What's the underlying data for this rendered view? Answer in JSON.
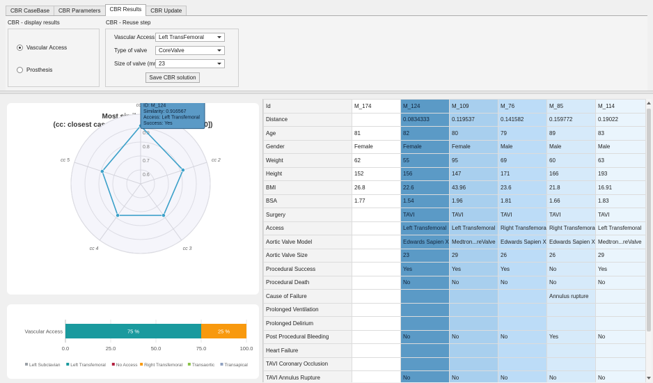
{
  "tabs": [
    {
      "label": "CBR CaseBase",
      "active": false
    },
    {
      "label": "CBR Parameters",
      "active": false
    },
    {
      "label": "CBR Results",
      "active": true
    },
    {
      "label": "CBR Update",
      "active": false
    }
  ],
  "display_results": {
    "title": "CBR - display results",
    "options": [
      {
        "label": "Vascular Access",
        "selected": true
      },
      {
        "label": "Prosthesis",
        "selected": false
      }
    ]
  },
  "reuse_step": {
    "title": "CBR - Reuse step",
    "fields": [
      {
        "label": "Vascular Access",
        "value": "Left TransFemoral"
      },
      {
        "label": "Type of valve",
        "value": "CoreValve"
      },
      {
        "label": "Size of valve (mm)",
        "value": "23"
      }
    ],
    "save_label": "Save CBR solution"
  },
  "radar": {
    "title": "Most similar cases",
    "subtitle": "(cc: closest cases; similarity measure: [0.0, 1.0])",
    "axes": [
      "cc 1",
      "cc 2",
      "cc 3",
      "cc 4",
      "cc 5"
    ],
    "rings": [
      "0.6",
      "0.7",
      "0.8",
      "0.9",
      "1"
    ],
    "tooltip": [
      "ID: M_124",
      "Similarity: 0.916567",
      "Access: Left Transfemoral",
      "Success: Yes"
    ]
  },
  "chart_data": [
    {
      "type": "radar",
      "title": "Most similar cases",
      "subtitle": "(cc: closest cases; similarity measure: [0.0, 1.0])",
      "categories": [
        "cc 1",
        "cc 2",
        "cc 3",
        "cc 4",
        "cc 5"
      ],
      "values": [
        0.9166,
        0.82,
        0.78,
        0.78,
        0.79
      ],
      "range": [
        0.5,
        1.0
      ],
      "series_color": "#3ba0c9"
    },
    {
      "type": "bar",
      "orientation": "horizontal",
      "stacked": true,
      "categories": [
        "Vascular Access"
      ],
      "series": [
        {
          "name": "Left Subclavian",
          "values": [
            0
          ],
          "color": "#9aa0a6"
        },
        {
          "name": "Left Transfemoral",
          "values": [
            75
          ],
          "color": "#1a9a9e"
        },
        {
          "name": "No Access",
          "values": [
            0
          ],
          "color": "#b3203f"
        },
        {
          "name": "Right Transfemoral",
          "values": [
            25
          ],
          "color": "#f8990e"
        },
        {
          "name": "Transaortic",
          "values": [
            0
          ],
          "color": "#8bc34a"
        },
        {
          "name": "Transapical",
          "values": [
            0
          ],
          "color": "#8fa0c0"
        }
      ],
      "segment_labels": [
        "75 %",
        "25 %"
      ],
      "xlim": [
        0,
        100
      ],
      "xticks": [
        "0.0",
        "25.0",
        "50.0",
        "75.0",
        "100.0"
      ],
      "legend": "bottom"
    }
  ],
  "table": {
    "rows": [
      [
        "Id",
        "M_174",
        "M_124",
        "M_109",
        "M_76",
        "M_85",
        "M_114"
      ],
      [
        "Distance",
        "",
        "0.0834333",
        "0.119537",
        "0.141582",
        "0.159772",
        "0.19022"
      ],
      [
        "Age",
        "81",
        "82",
        "80",
        "79",
        "89",
        "83"
      ],
      [
        "Gender",
        "Female",
        "Female",
        "Female",
        "Male",
        "Male",
        "Male"
      ],
      [
        "Weight",
        "62",
        "55",
        "95",
        "69",
        "60",
        "63"
      ],
      [
        "Height",
        "152",
        "156",
        "147",
        "171",
        "166",
        "193"
      ],
      [
        "BMI",
        "26.8",
        "22.6",
        "43.96",
        "23.6",
        "21.8",
        "16.91"
      ],
      [
        "BSA",
        "1.77",
        "1.54",
        "1.96",
        "1.81",
        "1.66",
        "1.83"
      ],
      [
        "Surgery",
        "",
        "TAVI",
        "TAVI",
        "TAVI",
        "TAVI",
        "TAVI"
      ],
      [
        "Access",
        "",
        "Left Transfemoral",
        "Left Transfemoral",
        "Right Transfemoral",
        "Right Transfemoral",
        "Left Transfemoral"
      ],
      [
        "Aortic Valve Model",
        "",
        "Edwards Sapien XT",
        "Medtron...reValve",
        "Edwards Sapien XT",
        "Edwards Sapien XT",
        "Medtron...reValve"
      ],
      [
        "Aortic Valve Size",
        "",
        "23",
        "29",
        "26",
        "26",
        "29"
      ],
      [
        "Procedural Success",
        "",
        "Yes",
        "Yes",
        "Yes",
        "No",
        "Yes"
      ],
      [
        "Procedural Death",
        "",
        "No",
        "No",
        "No",
        "No",
        "No"
      ],
      [
        "Cause of Failure",
        "",
        "",
        "",
        "",
        "Annulus rupture",
        ""
      ],
      [
        "Prolonged Ventilation",
        "",
        "",
        "",
        "",
        "",
        ""
      ],
      [
        "Prolonged Delirium",
        "",
        "",
        "",
        "",
        "",
        ""
      ],
      [
        "Post Procedural Bleeding",
        "",
        "No",
        "No",
        "No",
        "Yes",
        "No"
      ],
      [
        "Heart Failure",
        "",
        "",
        "",
        "",
        "",
        ""
      ],
      [
        "TAVI Coronary Occlusion",
        "",
        "",
        "",
        "",
        "",
        ""
      ],
      [
        "TAVI Annulus Rupture",
        "",
        "No",
        "No",
        "No",
        "No",
        "No"
      ]
    ]
  }
}
